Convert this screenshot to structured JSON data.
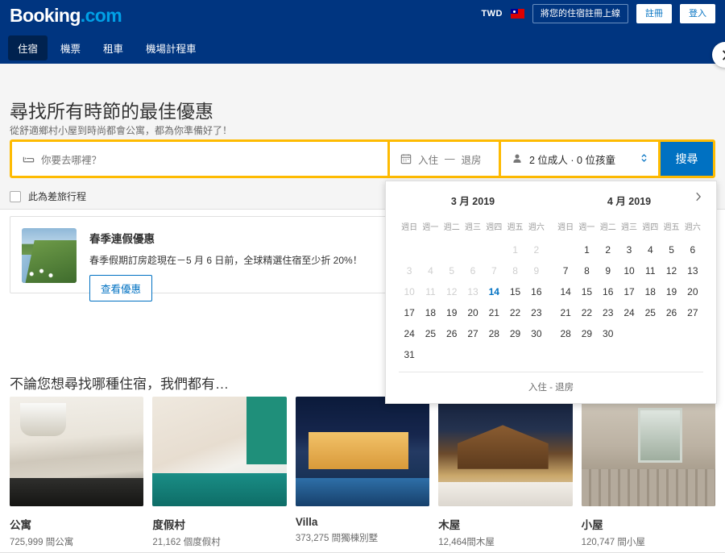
{
  "header": {
    "logo_main": "Booking",
    "logo_dot": ".com",
    "currency": "TWD",
    "flag_name": "taiwan-flag",
    "list_property_label": "將您的住宿註冊上線",
    "register_label": "註冊",
    "signin_label": "登入",
    "nav": [
      {
        "label": "住宿",
        "active": true
      },
      {
        "label": "機票",
        "active": false
      },
      {
        "label": "租車",
        "active": false
      },
      {
        "label": "機場計程車",
        "active": false
      }
    ]
  },
  "hero": {
    "title": "尋找所有時節的最佳優惠",
    "subtitle": "從舒適鄉村小屋到時尚都會公寓，都為你準備好了！",
    "search": {
      "destination_placeholder": "你要去哪裡？",
      "destination_value": "",
      "checkin_label": "入住",
      "dash": "—",
      "checkout_label": "退房",
      "guests_value": "2 位成人 · 0 位孩童",
      "search_button": "搜尋",
      "bed_icon": "bed-icon",
      "calendar_icon": "calendar-icon",
      "person_icon": "person-icon",
      "stepper_icon": "up-down-stepper-icon"
    },
    "business_trip_label": "此為差旅行程",
    "business_trip_checked": false
  },
  "calendar": {
    "next_icon": "chevron-right-icon",
    "weekdays": [
      "週日",
      "週一",
      "週二",
      "週三",
      "週四",
      "週五",
      "週六"
    ],
    "footer_label": "入住 - 退房",
    "months": [
      {
        "title": "3 月 2019",
        "lead_blanks": 5,
        "days": [
          {
            "n": 1,
            "state": "disabled"
          },
          {
            "n": 2,
            "state": "disabled"
          },
          {
            "n": 3,
            "state": "disabled"
          },
          {
            "n": 4,
            "state": "disabled"
          },
          {
            "n": 5,
            "state": "disabled"
          },
          {
            "n": 6,
            "state": "disabled"
          },
          {
            "n": 7,
            "state": "disabled"
          },
          {
            "n": 8,
            "state": "disabled"
          },
          {
            "n": 9,
            "state": "disabled"
          },
          {
            "n": 10,
            "state": "disabled"
          },
          {
            "n": 11,
            "state": "disabled"
          },
          {
            "n": 12,
            "state": "disabled"
          },
          {
            "n": 13,
            "state": "disabled"
          },
          {
            "n": 14,
            "state": "today"
          },
          {
            "n": 15,
            "state": "normal"
          },
          {
            "n": 16,
            "state": "normal"
          },
          {
            "n": 17,
            "state": "normal"
          },
          {
            "n": 18,
            "state": "normal"
          },
          {
            "n": 19,
            "state": "normal"
          },
          {
            "n": 20,
            "state": "normal"
          },
          {
            "n": 21,
            "state": "normal"
          },
          {
            "n": 22,
            "state": "normal"
          },
          {
            "n": 23,
            "state": "normal"
          },
          {
            "n": 24,
            "state": "normal"
          },
          {
            "n": 25,
            "state": "normal"
          },
          {
            "n": 26,
            "state": "normal"
          },
          {
            "n": 27,
            "state": "normal"
          },
          {
            "n": 28,
            "state": "normal"
          },
          {
            "n": 29,
            "state": "normal"
          },
          {
            "n": 30,
            "state": "normal"
          },
          {
            "n": 31,
            "state": "normal"
          }
        ]
      },
      {
        "title": "4 月 2019",
        "lead_blanks": 1,
        "days": [
          {
            "n": 1,
            "state": "normal"
          },
          {
            "n": 2,
            "state": "normal"
          },
          {
            "n": 3,
            "state": "normal"
          },
          {
            "n": 4,
            "state": "normal"
          },
          {
            "n": 5,
            "state": "normal"
          },
          {
            "n": 6,
            "state": "normal"
          },
          {
            "n": 7,
            "state": "normal"
          },
          {
            "n": 8,
            "state": "normal"
          },
          {
            "n": 9,
            "state": "normal"
          },
          {
            "n": 10,
            "state": "normal"
          },
          {
            "n": 11,
            "state": "normal"
          },
          {
            "n": 12,
            "state": "normal"
          },
          {
            "n": 13,
            "state": "normal"
          },
          {
            "n": 14,
            "state": "normal"
          },
          {
            "n": 15,
            "state": "normal"
          },
          {
            "n": 16,
            "state": "normal"
          },
          {
            "n": 17,
            "state": "normal"
          },
          {
            "n": 18,
            "state": "normal"
          },
          {
            "n": 19,
            "state": "normal"
          },
          {
            "n": 20,
            "state": "normal"
          },
          {
            "n": 21,
            "state": "normal"
          },
          {
            "n": 22,
            "state": "normal"
          },
          {
            "n": 23,
            "state": "normal"
          },
          {
            "n": 24,
            "state": "normal"
          },
          {
            "n": 25,
            "state": "normal"
          },
          {
            "n": 26,
            "state": "normal"
          },
          {
            "n": 27,
            "state": "normal"
          },
          {
            "n": 28,
            "state": "normal"
          },
          {
            "n": 29,
            "state": "normal"
          },
          {
            "n": 30,
            "state": "normal"
          }
        ]
      }
    ]
  },
  "promo": {
    "image_name": "coastal-cliff-photo",
    "title": "春季連假優惠",
    "description": "春季假期訂房趁現在－5 月 6 日前，全球精選住宿至少折 20%！",
    "button_label": "查看優惠"
  },
  "property_types": {
    "heading": "不論您想尋找哪種住宿，我們都有…",
    "next_icon": "chevron-right-icon",
    "cards": [
      {
        "name": "公寓",
        "count": "725,999 間公寓",
        "img_class": "img-apartment",
        "img_name": "apartment-kitchen-photo"
      },
      {
        "name": "度假村",
        "count": "21,162 個度假村",
        "img_class": "img-resort",
        "img_name": "resort-bedroom-photo"
      },
      {
        "name": "Villa",
        "count": "373,275 間獨棟別墅",
        "img_class": "img-villa",
        "img_name": "villa-pool-night-photo"
      },
      {
        "name": "木屋",
        "count": "12,464間木屋",
        "img_class": "img-cabin",
        "img_name": "wooden-cabin-snow-photo"
      },
      {
        "name": "小屋",
        "count": "120,747 間小屋",
        "img_class": "img-cottage",
        "img_name": "stone-cottage-photo"
      }
    ]
  },
  "colors": {
    "brand_blue": "#003580",
    "accent_yellow": "#febb02",
    "action_blue": "#0071c2",
    "today_blue": "#0071c2"
  }
}
